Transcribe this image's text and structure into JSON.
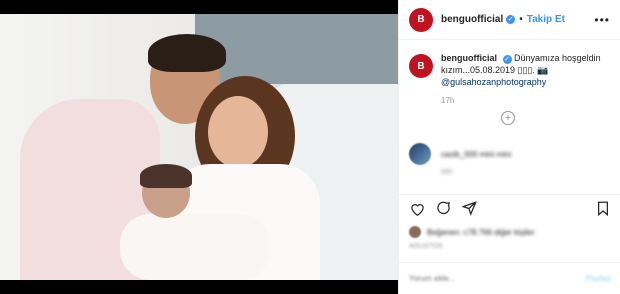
{
  "header": {
    "username": "benguofficial",
    "follow_label": "Takip Et",
    "dot": "•",
    "more_label": "•••",
    "verified_mark": "✓"
  },
  "caption": {
    "username": "benguofficial",
    "text": "Dünyamıza hoşgeldin kızım...05.08.2019 ▯▯▯. 📷",
    "mention": "@gulsahozanphotography",
    "time": "17h"
  },
  "comment": {
    "text": "cazib_000 mini mini",
    "meta": "88h"
  },
  "likes": {
    "text": "Beğenen: c78.766 diğer kişiler"
  },
  "post_date": "AGUSTOS",
  "comment_box": {
    "placeholder": "Yorum ekle...",
    "post_label": "Paylaş"
  },
  "icons": [
    "heart-icon",
    "comment-icon",
    "share-icon",
    "bookmark-icon",
    "add-comment-icon",
    "more-icon",
    "verified-icon"
  ],
  "colors": {
    "accent": "#3897f0",
    "avatar": "#c1121f"
  }
}
